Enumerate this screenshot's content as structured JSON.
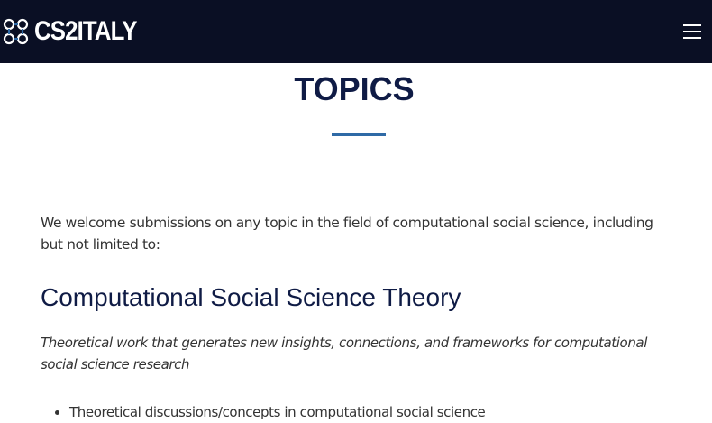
{
  "navbar": {
    "logo_text": "CS2ITALY",
    "logo_icon": "molecule-icon",
    "menu_icon": "hamburger-menu-icon",
    "background": "#0a0f24"
  },
  "page": {
    "title": "TOPICS",
    "accent_color": "#2f6aa6",
    "intro": "We welcome submissions on any topic in the field of computational social science, including but not limited to:"
  },
  "section": {
    "heading": "Computational Social Science Theory",
    "description": "Theoretical work that generates new insights, connections, and frameworks for computational social science research",
    "items": [
      "Theoretical discussions/concepts in computational social science"
    ]
  }
}
